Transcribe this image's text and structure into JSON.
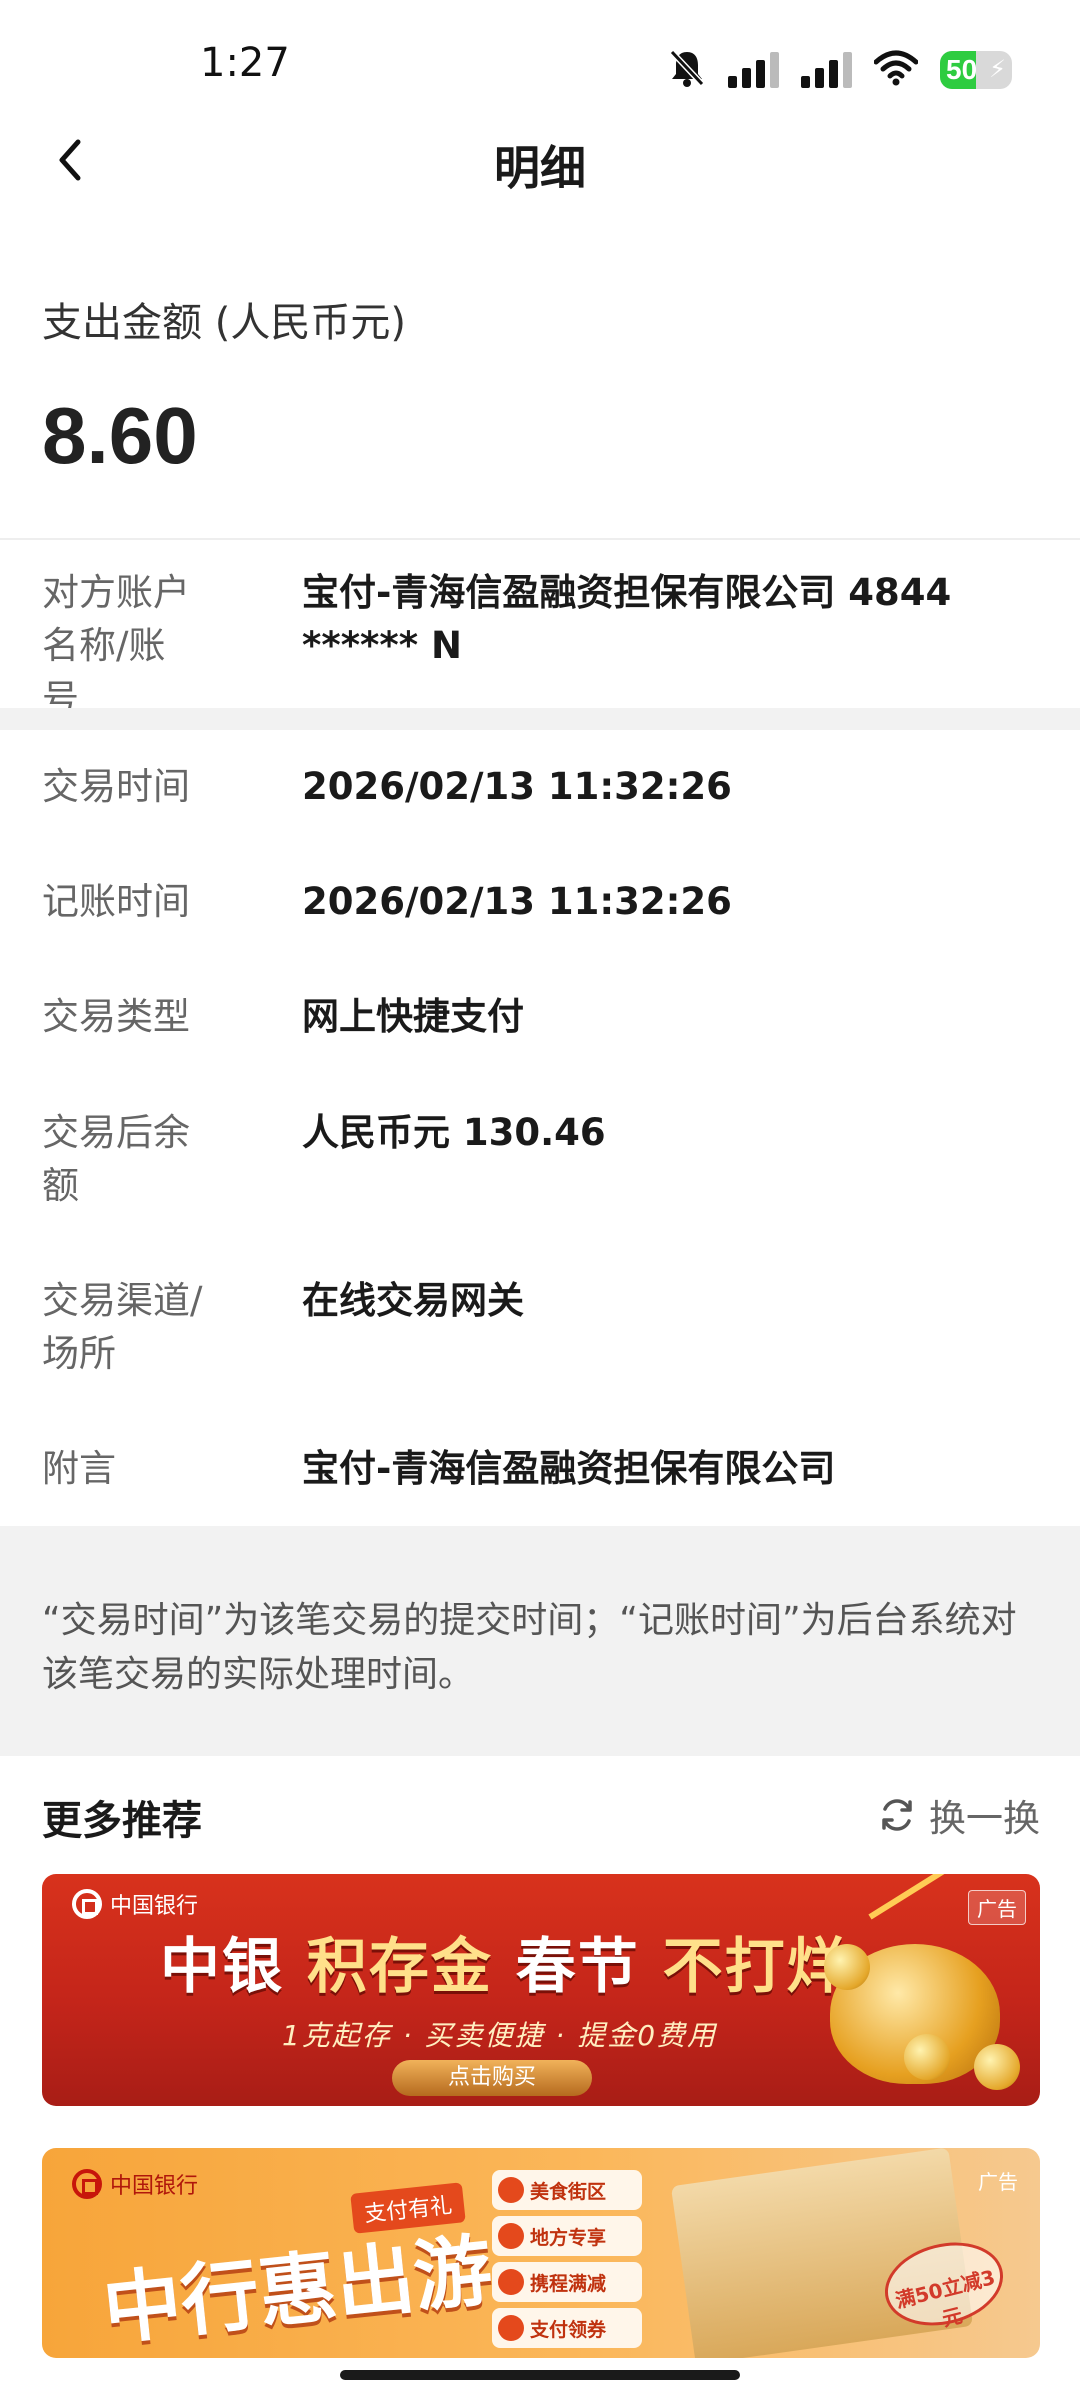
{
  "status_bar": {
    "time": "1:27",
    "battery_level": "50",
    "battery_fraction": 0.5,
    "icons": [
      "bell-muted-icon",
      "signal-icon",
      "signal-icon",
      "wifi-icon",
      "battery-charging-icon"
    ]
  },
  "header": {
    "title": "明细",
    "back_icon": "chevron-left-icon"
  },
  "amount": {
    "label": "支出金额 (人民币元)",
    "value": "8.60"
  },
  "counterparty": {
    "label": "对方账户名称/账号",
    "value": "宝付-青海信盈融资担保有限公司 4844 ****** N"
  },
  "details": [
    {
      "label": "交易时间",
      "value": "2026/02/13 11:32:26"
    },
    {
      "label": "记账时间",
      "value": "2026/02/13 11:32:26"
    },
    {
      "label": "交易类型",
      "value": "网上快捷支付"
    },
    {
      "label": "交易后余额",
      "value": "人民币元 130.46"
    },
    {
      "label": "交易渠道/场所",
      "value": "在线交易网关"
    },
    {
      "label": "附言",
      "value": "宝付-青海信盈融资担保有限公司"
    }
  ],
  "note": "“交易时间”为该笔交易的提交时间；“记账时间”为后台系统对该笔交易的实际处理时间。",
  "recommend": {
    "title": "更多推荐",
    "refresh_label": "换一换",
    "refresh_icon": "refresh-icon"
  },
  "banners": [
    {
      "ad_tag": "广告",
      "logo_text": "中国银行",
      "headline_a": "中银",
      "headline_b": "积存金",
      "headline_c": "春节",
      "headline_d": "不打烊",
      "sub": "1克起存 · 买卖便捷 · 提金0费用",
      "cta": "点击购买",
      "colors": {
        "primary": "#c4251a",
        "accent": "#ffe08a"
      }
    },
    {
      "ad_tag": "广告",
      "logo_text": "中国银行",
      "headline": "中行惠出游",
      "badge": "支付有礼",
      "items": [
        "美食街区",
        "地方专享",
        "携程满减",
        "支付领券"
      ],
      "stamp": "满50立减3元",
      "colors": {
        "primary": "#f7a53a",
        "accent": "#e4491c"
      }
    }
  ]
}
